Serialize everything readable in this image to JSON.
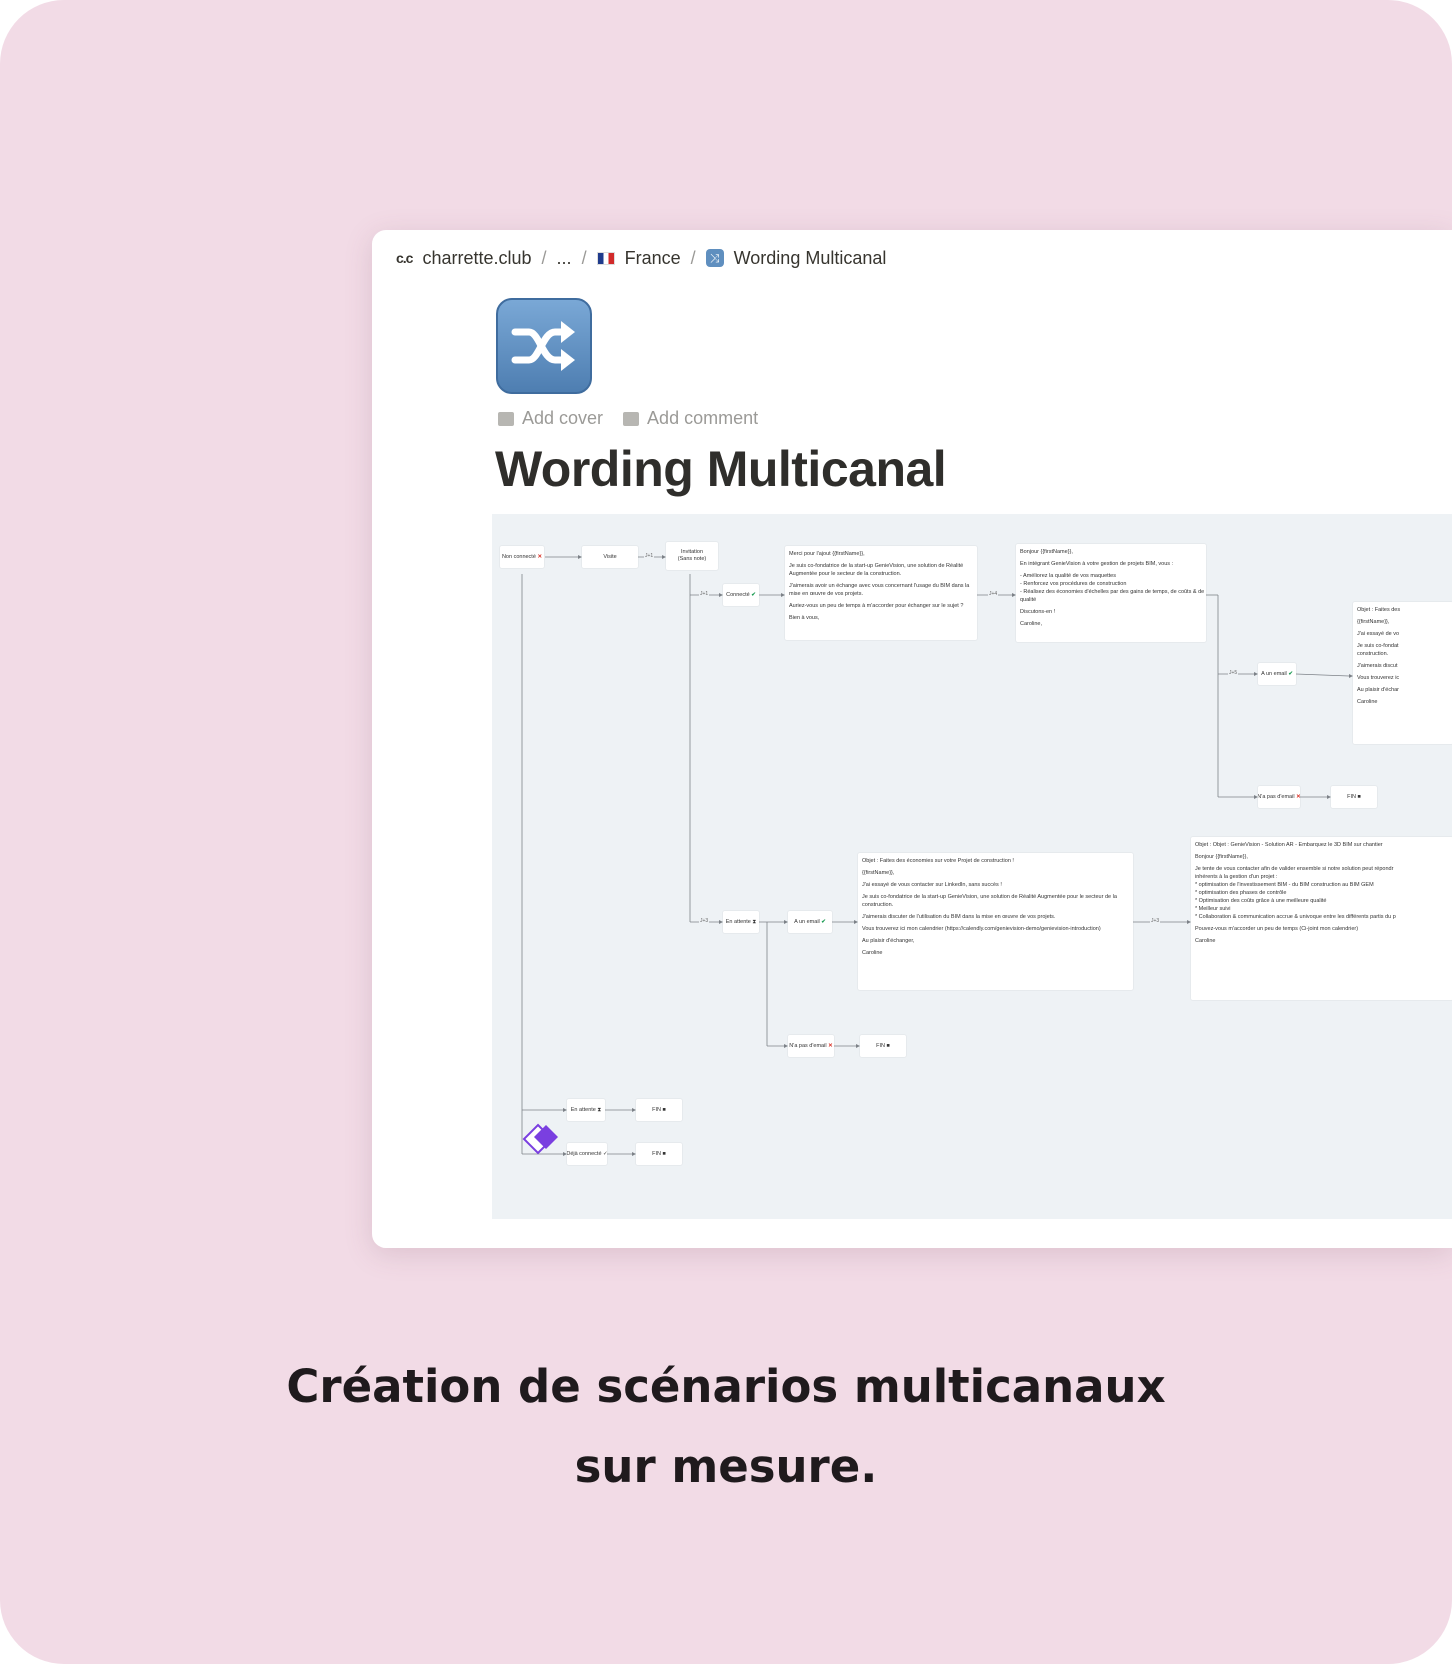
{
  "breadcrumb": {
    "logo": "c.c",
    "site": "charrette.club",
    "ellipsis": "...",
    "country": "France",
    "page": "Wording Multicanal"
  },
  "page_icon": "shuffle-icon",
  "actions": {
    "add_cover": "Add cover",
    "add_comment": "Add comment"
  },
  "title": "Wording Multicanal",
  "flow": {
    "n_nonconnecte": "Non connecté",
    "n_visite": "Visite",
    "n_invitation_1": "Invitation",
    "n_invitation_2": "(Sans note)",
    "n_connecte": "Connecté",
    "n_enattente": "En attente",
    "n_aunemail_1": "A un email",
    "n_napasemail_1": "N'a pas d'email",
    "n_fin_1": "FIN",
    "n_aunemail_2": "A un email",
    "n_napasemail_2": "N'a pas d'email",
    "n_fin_2": "FIN",
    "n_enattente_2": "En attente",
    "n_fin_3": "FIN",
    "n_dejaconnecte": "Déjà connecté",
    "n_fin_4": "FIN",
    "lbl_j1a": "J+1",
    "lbl_j1b": "J+1",
    "lbl_j4": "J+4",
    "lbl_j5": "J+5",
    "lbl_j3": "J+3",
    "lbl_j3b": "J+3",
    "msg1": [
      "Merci pour l'ajout {{firstName}},",
      "",
      "Je suis co-fondatrice de la start-up GenieVision, une solution de Réalité",
      "Augmentée pour le secteur de la construction.",
      "",
      "J'aimerais avoir un échange avec vous concernant l'usage du BIM dans la",
      "mise en œuvre de vos projets.",
      "",
      "Auriez-vous un peu de temps à m'accorder pour échanger sur le sujet ?",
      "",
      "Bien à vous,"
    ],
    "msg2": [
      "Bonjour {{firstName}},",
      "",
      "En intégrant GenieVision à votre gestion de projets BIM, vous :",
      "",
      "- Améliorez la qualité de vos maquettes",
      "- Renforcez vos procédures de construction",
      "- Réalisez des économies d'échelles par des gains de temps, de coûts & de",
      "qualité",
      "",
      "Discutons-en !",
      "",
      "Caroline,"
    ],
    "msg3": [
      "Objet : Faites des",
      "",
      "{{firstName}},",
      "",
      "J'ai essayé de vo",
      "",
      "Je suis co-fondat",
      "construction.",
      "",
      "J'aimerais discut",
      "",
      "Vous trouverez ic",
      "",
      "Au plaisir d'échar",
      "",
      "Caroline"
    ],
    "msg4": [
      "Objet : Faites des économies sur votre Projet de construction !",
      "",
      "{{firstName}},",
      "",
      "J'ai essayé de vous contacter sur LinkedIn, sans succès !",
      "",
      "Je suis co-fondatrice de la start-up GenieVision, une solution de Réalité Augmentée pour le secteur de la",
      "construction.",
      "",
      "J'aimerais discuter de l'utilisation du BIM dans la mise en œuvre de vos projets.",
      "",
      "Vous trouverez ici mon calendrier (https://calendly.com/genievision-demo/genievision-introduction)",
      "",
      "Au plaisir d'échanger,",
      "",
      "Caroline"
    ],
    "msg5": [
      "Objet : Objet : GenieVision - Solution AR  - Embarquez le 3D BIM sur chantier",
      "",
      "Bonjour {{firstName}},",
      "",
      "Je tente de vous contacter afin de valider ensemble si notre solution peut répondr",
      "inhérents à la gestion d'un projet :",
      "* optimisation de l'investissement BIM - du BIM construction au BIM GEM",
      "* optimisation des phases de contrôle",
      "* Optimisation des coûts grâce à une meilleure qualité",
      "* Meilleur suivi",
      "* Collaboration & communication accrue & univoque entre les différents partis du p",
      "",
      "Pouvez-vous m'accorder un peu de temps (Ci-joint mon calendrier)",
      "",
      "Caroline"
    ]
  },
  "caption": {
    "line1": "Création de scénarios multicanaux",
    "line2": "sur mesure."
  }
}
